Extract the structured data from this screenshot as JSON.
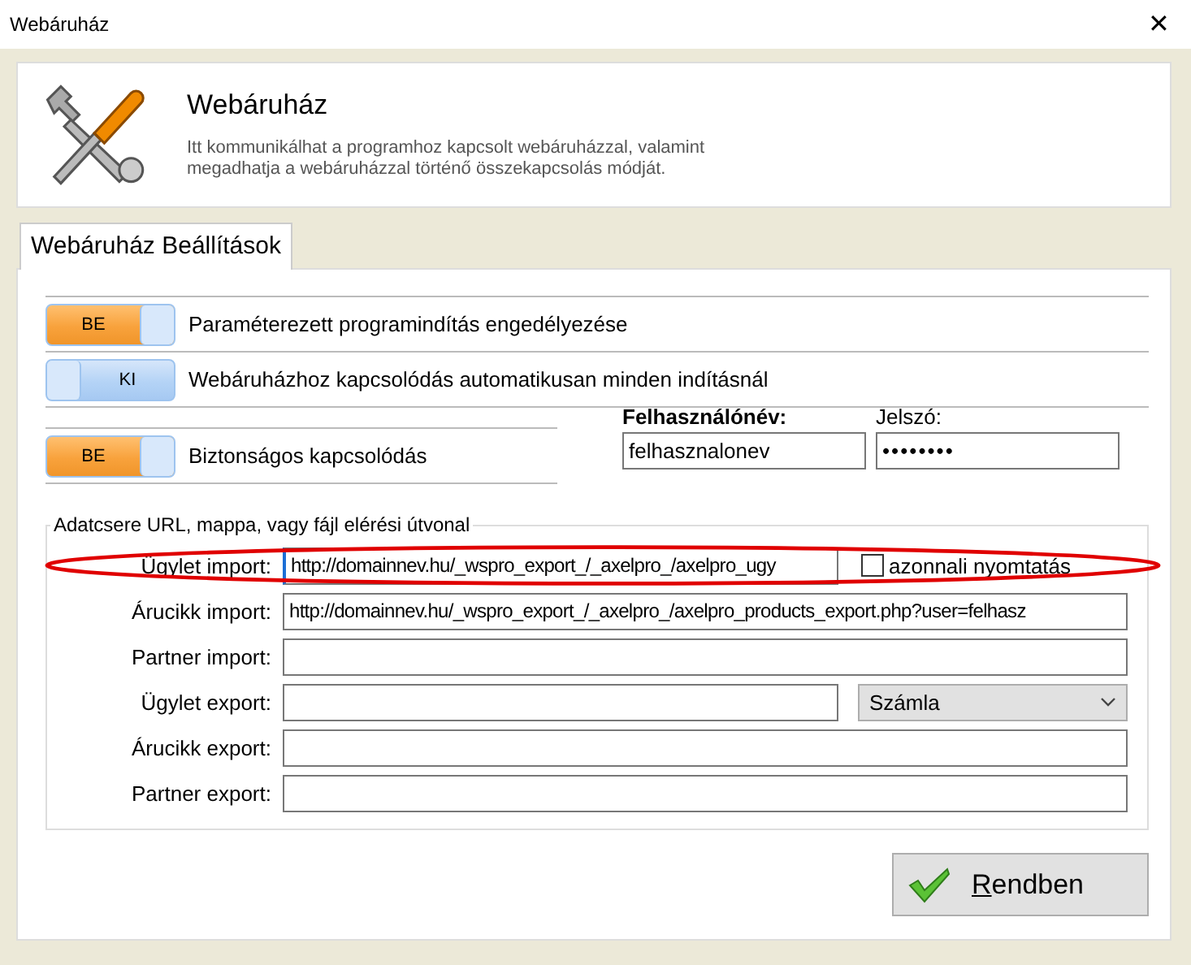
{
  "window": {
    "title": "Webáruház",
    "close": "✕"
  },
  "header": {
    "title": "Webáruház",
    "description": "Itt kommunikálhat a programhoz kapcsolt webáruházzal, valamint megadhatja a webáruházzal történő összekapcsolás módját."
  },
  "tabs": [
    {
      "label": "Webáruház Beállítások",
      "selected": true
    }
  ],
  "toggles": [
    {
      "state_label": "BE",
      "on": true,
      "label": "Paraméterezett programindítás engedélyezése"
    },
    {
      "state_label": "KI",
      "on": false,
      "label": "Webáruházhoz kapcsolódás automatikusan minden indításnál"
    },
    {
      "state_label": "BE",
      "on": true,
      "label": "Biztonságos kapcsolódás"
    }
  ],
  "credentials": {
    "username_label": "Felhasználónév:",
    "username": "felhasznalonev",
    "password_label": "Jelszó:",
    "password": "••••••••"
  },
  "exchange": {
    "title": "Adatcsere URL, mappa, vagy fájl elérési útvonal",
    "highlighted_row": true,
    "rows": [
      {
        "kind": "checkbox",
        "label": "Ügylet import:",
        "value": "http://domainnev.hu/_wspro_export_/_axelpro_/axelpro_ugy",
        "extra_label": "azonnali nyomtatás",
        "checked": false,
        "focused": true
      },
      {
        "kind": "text",
        "label": "Árucikk import:",
        "value": "http://domainnev.hu/_wspro_export_/_axelpro_/axelpro_products_export.php?user=felhasz"
      },
      {
        "kind": "text",
        "label": "Partner import:"
      },
      {
        "kind": "select",
        "label": "Ügylet export:",
        "extra_label": "Számla"
      },
      {
        "kind": "text",
        "label": "Árucikk export:"
      },
      {
        "kind": "text",
        "label": "Partner export:"
      }
    ]
  },
  "buttons": [
    {
      "label": "Rendben"
    }
  ]
}
